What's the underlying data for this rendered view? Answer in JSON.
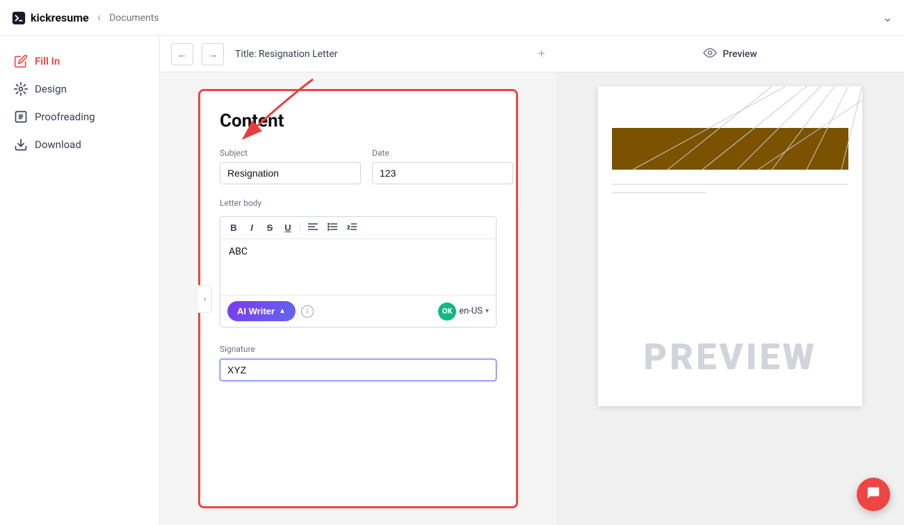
{
  "app": {
    "name": "kickresume",
    "logo_text": "kickresume"
  },
  "topnav": {
    "documents_label": "Documents",
    "chevron_down": "⌄"
  },
  "sidebar": {
    "items": [
      {
        "id": "fill-in",
        "label": "Fill In",
        "active": true
      },
      {
        "id": "design",
        "label": "Design",
        "active": false
      },
      {
        "id": "proofreading",
        "label": "Proofreading",
        "active": false
      },
      {
        "id": "download",
        "label": "Download",
        "active": false
      }
    ]
  },
  "toolbar": {
    "title": "Title: Resignation Letter",
    "add_section": "+"
  },
  "form": {
    "title": "Content",
    "subject_label": "Subject",
    "subject_value": "Resignation",
    "date_label": "Date",
    "date_value": "123",
    "letter_body_label": "Letter body",
    "letter_body_value": "ABC",
    "signature_label": "Signature",
    "signature_value": "XYZ"
  },
  "rich_toolbar": {
    "bold": "B",
    "italic": "I",
    "strikethrough": "S",
    "underline": "U",
    "align_left": "≡",
    "bullet_list": "≡",
    "numbered_list": "≡"
  },
  "ai_writer": {
    "label": "AI Writer",
    "chevron": "▲",
    "info": "i",
    "ok_label": "OK",
    "lang": "en-US"
  },
  "preview": {
    "label": "Preview",
    "watermark": "PREVIEW"
  },
  "colors": {
    "active_sidebar": "#ef4444",
    "ai_btn_start": "#7c3aed",
    "ai_btn_end": "#6366f1",
    "ok_green": "#10b981",
    "header_brown": "#7a5200",
    "border_red": "#ef4444"
  }
}
